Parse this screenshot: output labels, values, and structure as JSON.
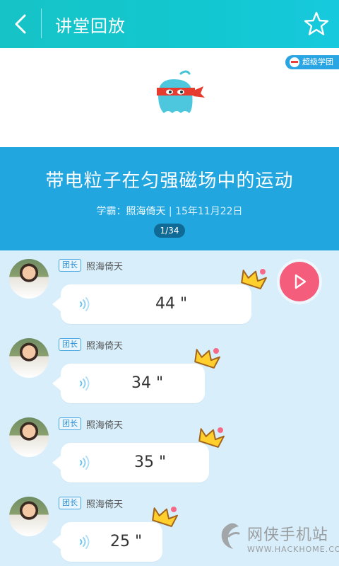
{
  "header": {
    "title": "讲堂回放",
    "back_icon": "back-icon",
    "favorite_icon": "star-icon"
  },
  "banner": {
    "brand_text": "超级学团",
    "mascot_icon": "mascot-icon"
  },
  "lesson": {
    "title": "带电粒子在匀强磁场中的运动",
    "meta_prefix": "学霸：",
    "meta_name": "照海倚天",
    "meta_date": " | 15年11月22日",
    "page": "1/34"
  },
  "messages": [
    {
      "role": "团长",
      "name": "照海倚天",
      "duration": "44 \""
    },
    {
      "role": "团长",
      "name": "照海倚天",
      "duration": "34 \""
    },
    {
      "role": "团长",
      "name": "照海倚天",
      "duration": "35 \""
    },
    {
      "role": "团长",
      "name": "照海倚天",
      "duration": "25 \""
    }
  ],
  "play_button": {
    "icon": "play-icon",
    "color": "#f45d7b"
  },
  "watermark": {
    "brand": "网侠手机站",
    "url": "WWW.HACKHOME.COM"
  },
  "colors": {
    "header": "#16c4c7",
    "info": "#22a6e0",
    "messages_bg": "#d8eefb"
  }
}
